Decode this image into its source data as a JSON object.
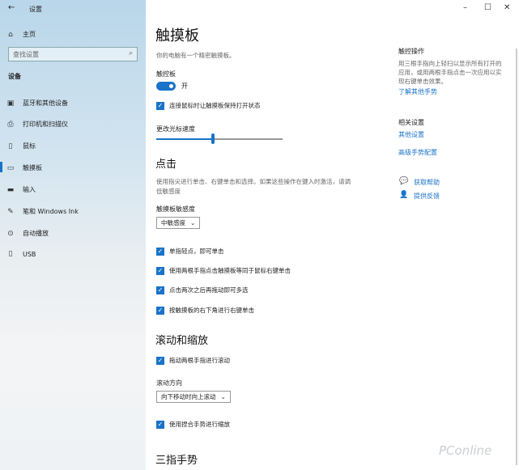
{
  "window": {
    "title": "设置",
    "minimize": "–",
    "maximize": "☐",
    "close": "✕"
  },
  "sidebar": {
    "home": "主页",
    "search_placeholder": "查找设置",
    "section": "设备",
    "items": [
      {
        "label": "蓝牙和其他设备",
        "icon": "bluetooth-devices-icon",
        "glyph": "▣"
      },
      {
        "label": "打印机和扫描仪",
        "icon": "printer-icon",
        "glyph": "⎙"
      },
      {
        "label": "鼠标",
        "icon": "mouse-icon",
        "glyph": "▯"
      },
      {
        "label": "触摸板",
        "icon": "touchpad-icon",
        "glyph": "▭",
        "active": true
      },
      {
        "label": "输入",
        "icon": "keyboard-icon",
        "glyph": "▬"
      },
      {
        "label": "笔和 Windows Ink",
        "icon": "pen-icon",
        "glyph": "✎"
      },
      {
        "label": "自动播放",
        "icon": "autoplay-icon",
        "glyph": "⊙"
      },
      {
        "label": "USB",
        "icon": "usb-icon",
        "glyph": "▯"
      }
    ]
  },
  "main": {
    "title": "触摸板",
    "description": "你的电脑有一个精密触摸板。",
    "touchpad_label": "触控板",
    "toggle_state": "开",
    "toggle_on": true,
    "keep_on_with_mouse": "连接鼠标时让触摸板保持打开状态",
    "cursor_speed_label": "更改光标速度",
    "cursor_speed_percent": 45,
    "taps": {
      "heading": "点击",
      "description_line1": "使用指尖进行单击、右键单击和选择。如果这些操作在键入时激活，请调",
      "description_line2": "低敏感度",
      "sensitivity_label": "触摸板敏感度",
      "sensitivity_value": "中敏感度",
      "options": [
        "单指轻点，即可单击",
        "使用两根手指点击触摸板等同于鼠标右键单击",
        "点击两次之后再拖动即可多选",
        "按触摸板的右下角进行右键单击"
      ]
    },
    "scroll": {
      "heading": "滚动和缩放",
      "drag_two_fingers": "拖动两根手指进行滚动",
      "direction_label": "滚动方向",
      "direction_value": "向下移动时向上滚动",
      "pinch_zoom": "使用捏合手势进行缩放"
    },
    "three_finger": {
      "heading": "三指手势"
    }
  },
  "right": {
    "gestures_heading": "触控操作",
    "gestures_text": [
      "用三根手指向上轻扫以显示所有打开的",
      "应用，或用两根手指点击一次应用以实",
      "现右键单击效果。"
    ],
    "gestures_link": "了解其他手势",
    "related_heading": "相关设置",
    "related_links": [
      "其他设置",
      "高级手势配置"
    ],
    "help": "获取帮助",
    "feedback": "提供反馈"
  },
  "watermark": "PConline",
  "colors": {
    "accent": "#1a73c8"
  }
}
